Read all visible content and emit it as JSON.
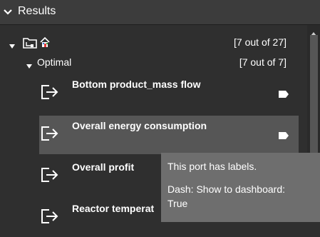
{
  "header": {
    "title": "Results",
    "chevron_icon": "chevron-down-icon"
  },
  "tree": {
    "root": {
      "count": "[7 out of 27]",
      "icons": [
        "folder-icon",
        "home-icon"
      ]
    },
    "group": {
      "label": "Optimal",
      "count": "[7 out of 7]"
    },
    "ports": [
      {
        "name": "Bottom product_mass flow",
        "icon": "output-port-icon",
        "has_label_tag": true
      },
      {
        "name": "Overall energy consumption",
        "icon": "output-port-icon",
        "has_label_tag": true,
        "highlighted": true
      },
      {
        "name": "Overall profit",
        "icon": "output-port-icon",
        "has_label_tag": false
      },
      {
        "name": "Reactor temperat",
        "icon": "output-port-icon",
        "has_label_tag": false
      }
    ]
  },
  "tooltip": {
    "line1": "This port has labels.",
    "line2": "Dash: Show to dashboard:",
    "line3": "True"
  },
  "colors": {
    "background": "#2f2f2f",
    "header": "#3c3c3c",
    "highlight": "#565656",
    "tooltip": "#6e6e6e",
    "text": "#ffffff"
  }
}
